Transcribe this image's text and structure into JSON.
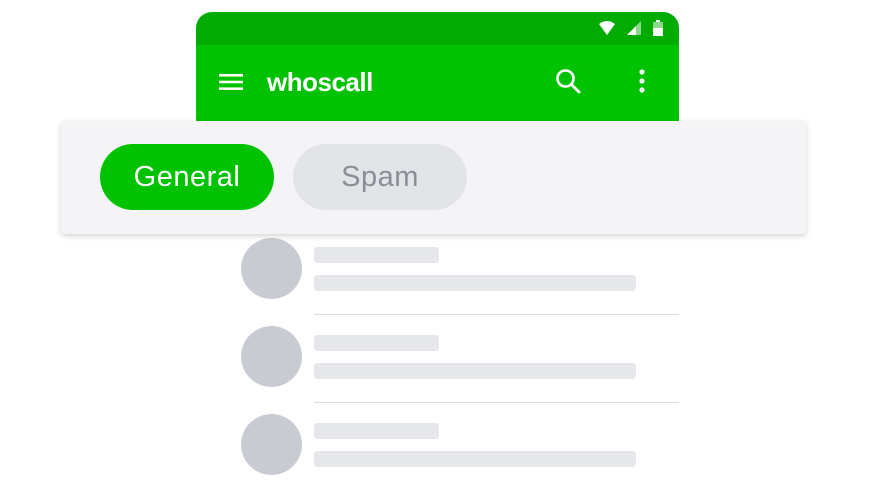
{
  "app": {
    "brand": "whoscall"
  },
  "status_bar": {
    "icons": [
      "wifi-icon",
      "signal-icon",
      "battery-icon"
    ]
  },
  "app_bar": {
    "icons": [
      "menu-icon",
      "search-icon",
      "more-vert-icon"
    ]
  },
  "tabs": [
    {
      "label": "General",
      "selected": true
    },
    {
      "label": "Spam",
      "selected": false
    }
  ],
  "colors": {
    "status_bar": "#00ac00",
    "app_bar": "#00c200",
    "tab_selected": "#00c200",
    "tab_unselected": "#e3e4e7",
    "placeholder_avatar": "#c8cbd1",
    "placeholder_line": "#e6e7ea"
  }
}
